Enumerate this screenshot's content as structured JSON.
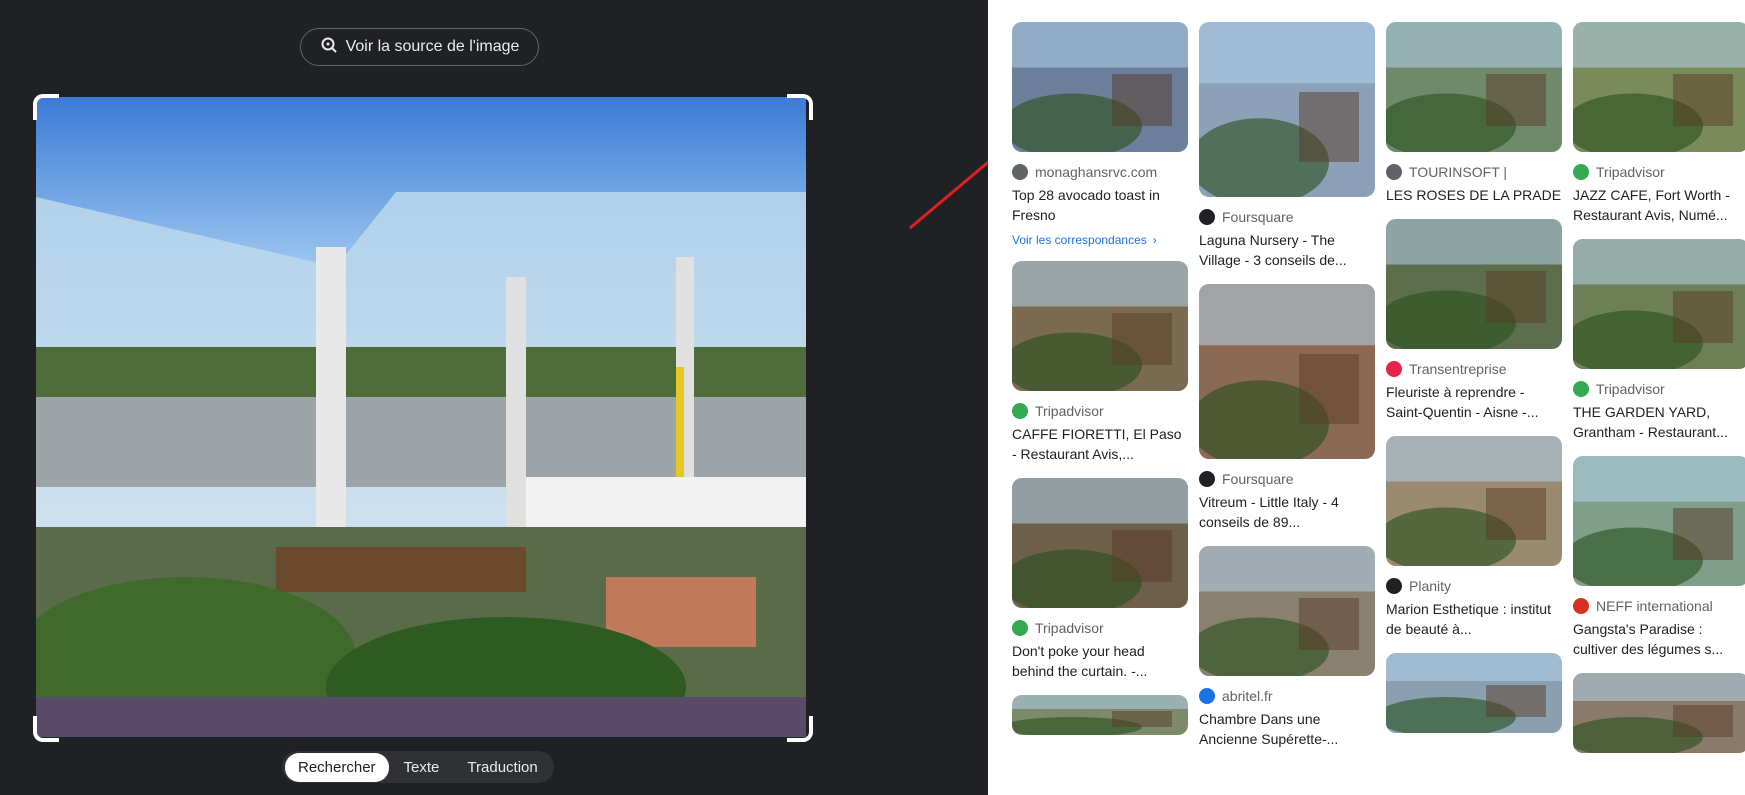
{
  "source_button": {
    "label": "Voir la source de l'image",
    "icon": "lens-icon"
  },
  "modes": [
    {
      "label": "Rechercher",
      "active": true
    },
    {
      "label": "Texte",
      "active": false
    },
    {
      "label": "Traduction",
      "active": false
    }
  ],
  "columns": [
    [
      {
        "source": "monaghansrvc.com",
        "title": "Top 28 avocado toast in Fresno",
        "match": "Voir les correspondances",
        "favicon_color": "#5f6368",
        "img_h": 130,
        "bg": "#6b7f9a"
      },
      {
        "source": "Tripadvisor",
        "title": "CAFFE FIORETTI, El Paso - Restaurant Avis,...",
        "favicon_color": "#34a853",
        "img_h": 130,
        "bg": "#7a6a52"
      },
      {
        "source": "Tripadvisor",
        "title": "Don't poke your head behind the curtain. -...",
        "favicon_color": "#34a853",
        "img_h": 130,
        "bg": "#6d5f4a"
      },
      {
        "source": "",
        "title": "",
        "favicon_color": "#34a853",
        "img_h": 40,
        "bg": "#7d8a6a"
      }
    ],
    [
      {
        "source": "Foursquare",
        "title": "Laguna Nursery - The Village - 3 conseils de...",
        "favicon_color": "#202124",
        "img_h": 175,
        "bg": "#8ca0b8"
      },
      {
        "source": "Foursquare",
        "title": "Vitreum - Little Italy - 4 conseils de 89...",
        "favicon_color": "#202124",
        "img_h": 175,
        "bg": "#8a6a55"
      },
      {
        "source": "abritel.fr",
        "title": "Chambre Dans une Ancienne Supérette-...",
        "favicon_color": "#1a73e8",
        "img_h": 130,
        "bg": "#8a8070"
      }
    ],
    [
      {
        "source": "TOURINSOFT |",
        "title": "LES ROSES DE LA PRADE",
        "favicon_color": "#5f6368",
        "img_h": 130,
        "bg": "#6f8a6a"
      },
      {
        "source": "Transentreprise",
        "title": "Fleuriste à reprendre - Saint-Quentin - Aisne -...",
        "favicon_color": "#e8234a",
        "img_h": 130,
        "bg": "#5c6e4c"
      },
      {
        "source": "Planity",
        "title": "Marion Esthetique : institut de beauté à...",
        "favicon_color": "#202124",
        "img_h": 130,
        "bg": "#9a8a70"
      },
      {
        "source": "",
        "title": "",
        "favicon_color": "#202124",
        "img_h": 80,
        "bg": "#8aa0b0"
      }
    ],
    [
      {
        "source": "Tripadvisor",
        "title": "JAZZ CAFE, Fort Worth - Restaurant Avis, Numé...",
        "favicon_color": "#34a853",
        "img_h": 130,
        "bg": "#7a8a5a"
      },
      {
        "source": "Tripadvisor",
        "title": "THE GARDEN YARD, Grantham - Restaurant...",
        "favicon_color": "#34a853",
        "img_h": 130,
        "bg": "#6e7f58"
      },
      {
        "source": "NEFF international",
        "title": "Gangsta's Paradise : cultiver des légumes s...",
        "favicon_color": "#d93025",
        "img_h": 130,
        "bg": "#7f9f8a"
      },
      {
        "source": "",
        "title": "",
        "favicon_color": "#d93025",
        "img_h": 80,
        "bg": "#8a7a6a"
      }
    ]
  ]
}
